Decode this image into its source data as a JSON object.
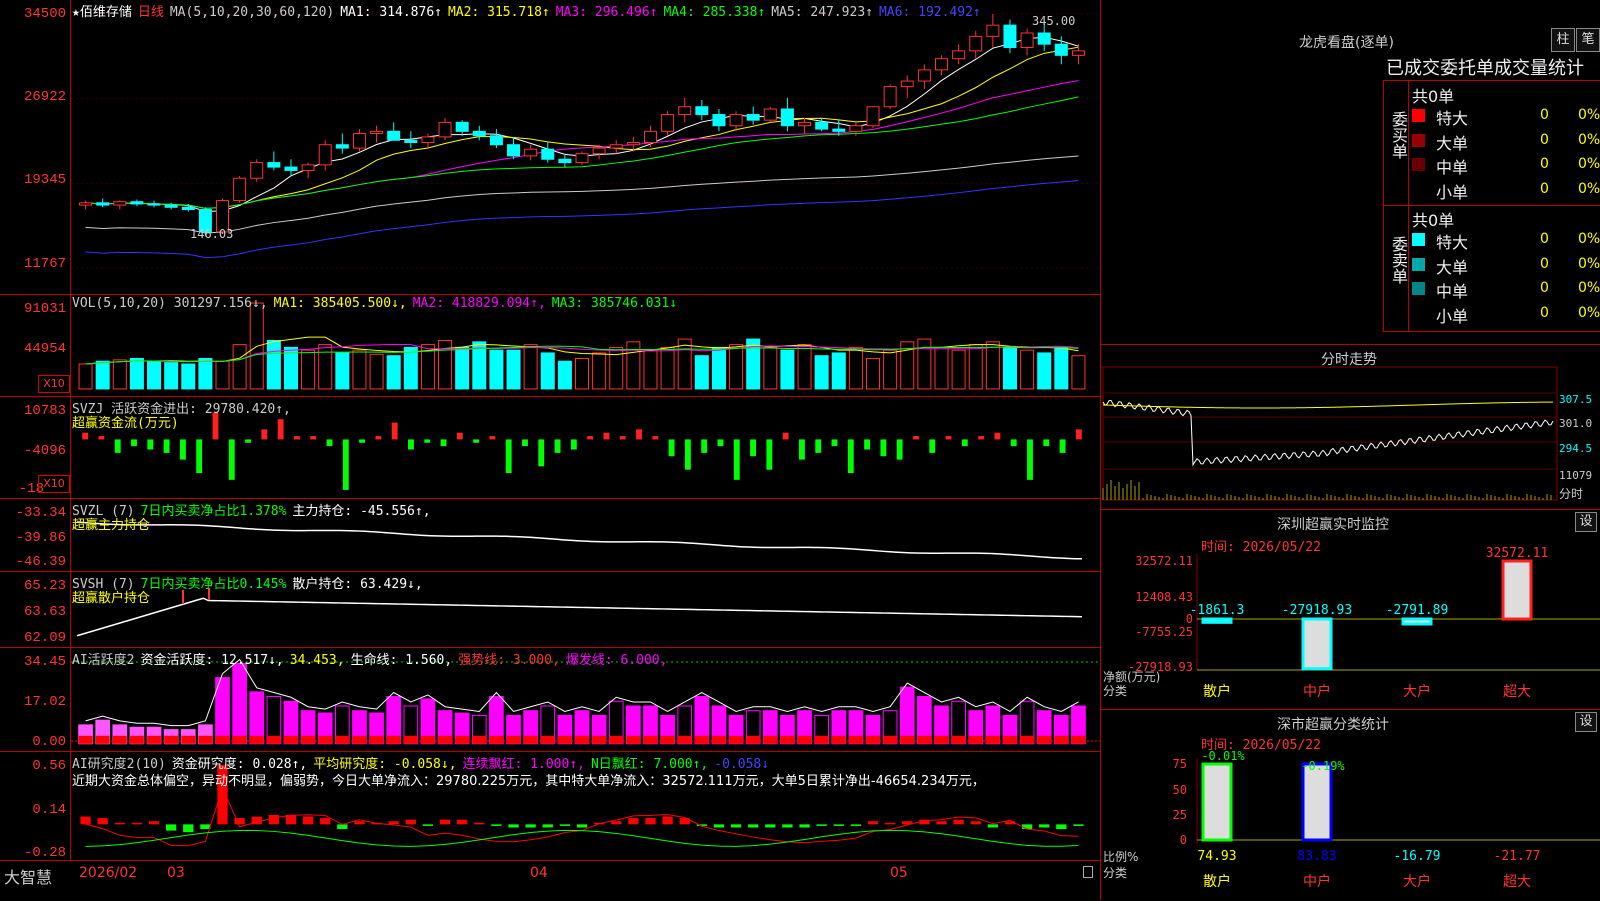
{
  "stock": {
    "name": "佰维存储",
    "period": "日线",
    "star": "★"
  },
  "ma_header": {
    "params": "MA(5,10,20,30,60,120)",
    "ma1": "MA1: 314.876↑",
    "ma2": "MA2: 315.718↑",
    "ma3": "MA3: 296.496↑",
    "ma4": "MA4: 285.338↑",
    "ma5": "MA5: 247.923↑",
    "ma6": "MA6: 192.492↑",
    "colors": {
      "ma1": "#ffffff",
      "ma2": "#ffff00",
      "ma3": "#ff00ff",
      "ma4": "#00ff00",
      "ma5": "#cccccc",
      "ma6": "#3333ff"
    }
  },
  "price_axis": [
    "34500",
    "26922",
    "19345",
    "11767"
  ],
  "price_annotations": {
    "high": "345.00",
    "low": "146.03"
  },
  "vol": {
    "header": [
      "VOL(5,10,20) 301297.156↓,",
      "MA1: 385405.500↓,",
      "MA2: 418829.094↑,",
      "MA3: 385746.031↓"
    ],
    "axis": [
      "91031",
      "44954"
    ],
    "x10": "X10"
  },
  "svzj": {
    "header": "SVZJ  活跃资金进出: 29780.420↑,",
    "subtitle": "超赢资金流(万元)",
    "axis": [
      "10783",
      "-4096",
      "-18"
    ],
    "x10": "X10"
  },
  "svzl": {
    "header_a": "SVZL (7)",
    "header_b": "7日内买卖净占比1.378%",
    "header_c": "主力持仓: -45.556↑,",
    "subtitle": "超赢主力持仓",
    "axis": [
      "-33.34",
      "-39.86",
      "-46.39"
    ]
  },
  "svsh": {
    "header_a": "SVSH (7)",
    "header_b": "7日内买卖净占比0.145%",
    "header_c": "散户持仓: 63.429↓,",
    "subtitle": "超赢散户持仓",
    "axis": [
      "65.23",
      "63.63",
      "62.09"
    ]
  },
  "ai_act": {
    "header_a": "AI活跃度2",
    "header_b": "资金活跃度: 12.517↓,",
    "header_c": "34.453,",
    "header_d": "生命线: 1.560,",
    "header_e": "强势线: 3.000,",
    "header_f": "爆发线: 6.000,",
    "axis": [
      "34.45",
      "17.02",
      "0.00"
    ]
  },
  "ai_res": {
    "header_a": "AI研究度2(10)",
    "header_b": "资金研究度: 0.028↑,",
    "header_c": "平均研究度: -0.058↓,",
    "header_d": "连续飘红: 1.000↑,",
    "header_e": "N日飘红: 7.000↑,",
    "header_f": "-0.058↓",
    "summary": "近期大资金总体偏空，异动不明显，偏弱势，今日大单净流入：29780.225万元，其中特大单净流入：32572.111万元，大单5日累计净出-46654.234万元，",
    "axis": [
      "0.56",
      "0.14",
      "-0.28"
    ]
  },
  "bottom_bar": {
    "brand": "大智慧",
    "dates": [
      "2026/02",
      "03",
      "04",
      "05"
    ]
  },
  "right": {
    "lhb_title": "龙虎看盘(逐单)",
    "btn_zhu": "柱",
    "btn_bi": "笔",
    "stats_title": "已成交委托单成交量统计",
    "buy_label": "委买单",
    "sell_label": "委卖单",
    "buy_total": "共0单",
    "sell_total": "共0单",
    "buy_rows": [
      {
        "label": "特大",
        "val": "0",
        "pct": "0%",
        "color": "#ff0000"
      },
      {
        "label": "大单",
        "val": "0",
        "pct": "0%",
        "color": "#990000"
      },
      {
        "label": "中单",
        "val": "0",
        "pct": "0%",
        "color": "#660000"
      },
      {
        "label": "小单",
        "val": "0",
        "pct": "0%",
        "color": "#000000"
      }
    ],
    "sell_rows": [
      {
        "label": "特大",
        "val": "0",
        "pct": "0%",
        "color": "#00ffff"
      },
      {
        "label": "大单",
        "val": "0",
        "pct": "0%",
        "color": "#00aaaa"
      },
      {
        "label": "中单",
        "val": "0",
        "pct": "0%",
        "color": "#008888"
      },
      {
        "label": "小单",
        "val": "0",
        "pct": "0%",
        "color": "#000000"
      }
    ],
    "intraday_title": "分时走势",
    "intraday_axis": [
      "307.5",
      "301.0",
      "294.5",
      "11079"
    ],
    "intraday_unit": "分时",
    "sz_title": "深圳超赢实时监控",
    "sz_btn": "设",
    "sz_time": "时间: 2026/05/22",
    "sz_axis": [
      "32572.11",
      "12408.43",
      "0",
      "-7755.25",
      "-27918.93"
    ],
    "sz_unit": "净额(万元)",
    "sz_cat_label": "分类",
    "sz_cats": [
      "散户",
      "中户",
      "大户",
      "超大"
    ],
    "sz_values": [
      -1861.3,
      -27918.93,
      -2791.89,
      32572.11
    ],
    "sz_value_labels": [
      "-1861.3",
      "-27918.93",
      "-2791.89",
      "32572.11"
    ],
    "cls_title": "深市超赢分类统计",
    "cls_btn": "设",
    "cls_time": "时间: 2026/05/22",
    "cls_axis": [
      "75",
      "50",
      "25",
      "0"
    ],
    "cls_unit": "比例%",
    "cls_cat_label": "分类",
    "cls_top": [
      "-0.01%",
      "-0.19%"
    ],
    "cls_vals": [
      "74.93",
      "83.83",
      "-16.79",
      "-21.77"
    ],
    "cls_cats": [
      "散户",
      "中户",
      "大户",
      "超大"
    ]
  },
  "chart_data": [
    {
      "type": "candlestick",
      "title": "佰维存储 日线",
      "ylim": [
        117.67,
        345.0
      ],
      "note": "price in yuan; axis labels printed ×100",
      "ohlc": [
        [
          174,
          178,
          170,
          176
        ],
        [
          176,
          180,
          172,
          174
        ],
        [
          174,
          178,
          170,
          177
        ],
        [
          177,
          179,
          173,
          175
        ],
        [
          175,
          178,
          172,
          174
        ],
        [
          174,
          176,
          170,
          172
        ],
        [
          172,
          175,
          168,
          170
        ],
        [
          170,
          172,
          146,
          150
        ],
        [
          150,
          180,
          148,
          178
        ],
        [
          178,
          200,
          176,
          198
        ],
        [
          198,
          215,
          195,
          212
        ],
        [
          212,
          222,
          205,
          208
        ],
        [
          208,
          215,
          200,
          205
        ],
        [
          205,
          212,
          198,
          210
        ],
        [
          210,
          232,
          205,
          228
        ],
        [
          228,
          238,
          220,
          225
        ],
        [
          225,
          242,
          222,
          238
        ],
        [
          238,
          245,
          230,
          240
        ],
        [
          240,
          248,
          235,
          232
        ],
        [
          232,
          240,
          225,
          230
        ],
        [
          230,
          238,
          224,
          235
        ],
        [
          235,
          252,
          232,
          248
        ],
        [
          248,
          250,
          236,
          240
        ],
        [
          240,
          245,
          232,
          236
        ],
        [
          236,
          242,
          225,
          228
        ],
        [
          228,
          235,
          215,
          218
        ],
        [
          218,
          228,
          214,
          224
        ],
        [
          224,
          230,
          212,
          215
        ],
        [
          215,
          220,
          208,
          212
        ],
        [
          212,
          222,
          210,
          220
        ],
        [
          220,
          228,
          215,
          225
        ],
        [
          225,
          232,
          220,
          228
        ],
        [
          228,
          235,
          222,
          230
        ],
        [
          230,
          245,
          226,
          240
        ],
        [
          240,
          258,
          236,
          255
        ],
        [
          255,
          270,
          248,
          262
        ],
        [
          262,
          268,
          250,
          255
        ],
        [
          255,
          260,
          240,
          245
        ],
        [
          245,
          258,
          240,
          255
        ],
        [
          255,
          262,
          246,
          250
        ],
        [
          250,
          262,
          248,
          260
        ],
        [
          260,
          270,
          240,
          245
        ],
        [
          245,
          252,
          238,
          248
        ],
        [
          248,
          252,
          240,
          242
        ],
        [
          242,
          250,
          236,
          240
        ],
        [
          240,
          248,
          236,
          245
        ],
        [
          245,
          262,
          243,
          262
        ],
        [
          262,
          282,
          260,
          280
        ],
        [
          280,
          290,
          270,
          285
        ],
        [
          285,
          300,
          278,
          295
        ],
        [
          295,
          308,
          290,
          305
        ],
        [
          305,
          318,
          300,
          312
        ],
        [
          312,
          330,
          305,
          325
        ],
        [
          325,
          345,
          315,
          335
        ],
        [
          335,
          340,
          310,
          315
        ],
        [
          315,
          332,
          308,
          328
        ],
        [
          328,
          336,
          312,
          318
        ],
        [
          318,
          325,
          300,
          308
        ],
        [
          308,
          318,
          300,
          312
        ]
      ],
      "ma": {
        "MA1": 314.876,
        "MA2": 315.718,
        "MA3": 296.496,
        "MA4": 285.338,
        "MA5": 247.923,
        "MA6": 192.492
      }
    },
    {
      "type": "bar",
      "title": "VOL(5,10,20)",
      "ylim": [
        0,
        91031
      ],
      "values": [
        18,
        20,
        21,
        22,
        20,
        19,
        18,
        22,
        20,
        32,
        62,
        35,
        30,
        28,
        32,
        26,
        28,
        25,
        24,
        30,
        32,
        35,
        30,
        34,
        28,
        28,
        32,
        26,
        20,
        22,
        26,
        30,
        34,
        28,
        30,
        36,
        24,
        30,
        32,
        36,
        30,
        28,
        32,
        24,
        26,
        30,
        22,
        28,
        34,
        36,
        30,
        28,
        32,
        34,
        30,
        28,
        26,
        30,
        24
      ]
    },
    {
      "type": "bar",
      "title": "SVZJ 活跃资金进出",
      "ylim": [
        -18,
        10783
      ],
      "values": [
        2,
        1,
        -4,
        -2,
        -3,
        -4,
        -6,
        -10,
        8,
        -12,
        -1,
        3,
        6,
        1,
        1,
        -2,
        -15,
        -1,
        1,
        5,
        -3,
        -1,
        -2,
        2,
        -1,
        1,
        -10,
        -2,
        -8,
        -4,
        -3,
        1,
        2,
        1,
        3,
        1,
        -5,
        -9,
        -4,
        -2,
        -12,
        -5,
        -9,
        2,
        -6,
        -4,
        -2,
        -10,
        -3,
        -5,
        -6,
        1,
        -4,
        1,
        -2,
        1,
        2,
        -2,
        -12,
        -2,
        -4,
        3
      ]
    },
    {
      "type": "line",
      "title": "SVZL 主力持仓",
      "ylim": [
        -46.39,
        -33.34
      ],
      "last": -45.556
    },
    {
      "type": "line",
      "title": "SVSH 散户持仓",
      "ylim": [
        62.09,
        65.23
      ],
      "last": 63.429
    },
    {
      "type": "bar",
      "title": "AI活跃度2 资金活跃度",
      "ylim": [
        0,
        34.45
      ],
      "values": [
        8,
        10,
        8,
        7,
        7,
        6,
        6,
        8,
        28,
        34,
        22,
        20,
        18,
        14,
        13,
        16,
        14,
        13,
        20,
        16,
        19,
        14,
        13,
        12,
        20,
        12,
        14,
        16,
        12,
        14,
        12,
        18,
        16,
        16,
        12,
        16,
        20,
        16,
        12,
        14,
        14,
        12,
        14,
        12,
        14,
        14,
        12,
        14,
        24,
        20,
        16,
        18,
        14,
        16,
        12,
        18,
        14,
        12,
        16
      ]
    },
    {
      "type": "bar",
      "title": "AI研究度2(10)",
      "ylim": [
        -0.28,
        0.56
      ],
      "values": [
        0.05,
        0.04,
        0.01,
        0.01,
        0.02,
        -0.04,
        -0.05,
        -0.03,
        0.38,
        0.04,
        0.05,
        0.06,
        0.06,
        0.05,
        0.04,
        -0.03,
        0.02,
        0.01,
        0.02,
        0.03,
        -0.01,
        0.03,
        0.03,
        0.01,
        -0.01,
        -0.02,
        -0.02,
        -0.02,
        -0.01,
        -0.02,
        0.01,
        0.02,
        0.04,
        0.04,
        0.05,
        0.04,
        -0.01,
        -0.02,
        -0.02,
        -0.02,
        -0.02,
        -0.02,
        -0.02,
        -0.01,
        -0.01,
        -0.01,
        0.02,
        0.01,
        0.02,
        0.03,
        0.02,
        0.03,
        0.02,
        -0.02,
        0.02,
        -0.03,
        -0.02,
        -0.03,
        -0.01
      ]
    },
    {
      "type": "bar",
      "title": "深圳超赢实时监控",
      "categories": [
        "散户",
        "中户",
        "大户",
        "超大"
      ],
      "values": [
        -1861.3,
        -27918.93,
        -2791.89,
        32572.11
      ],
      "ylim": [
        -27918.93,
        32572.11
      ]
    },
    {
      "type": "bar",
      "title": "深市超赢分类统计",
      "categories": [
        "散户",
        "中户",
        "大户",
        "超大"
      ],
      "values": [
        74.93,
        83.83,
        -16.79,
        -21.77
      ],
      "ylim": [
        0,
        75
      ]
    }
  ]
}
